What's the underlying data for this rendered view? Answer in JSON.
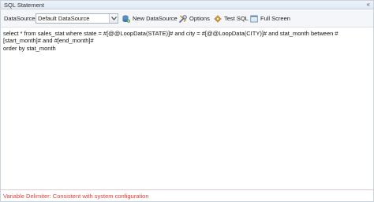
{
  "window": {
    "title": "SQL Statement"
  },
  "toolbar": {
    "datasource_label": "DataSource",
    "datasource_value": "Default DataSource",
    "buttons": [
      {
        "label": "New DataSource",
        "icon": "datasource-add-icon"
      },
      {
        "label": "Options",
        "icon": "options-icon"
      },
      {
        "label": "Test SQL",
        "icon": "test-sql-icon"
      },
      {
        "label": "Full Screen",
        "icon": "full-screen-icon"
      }
    ]
  },
  "editor": {
    "sql": "select * from sales_stat where state = #[@@LoopData(STATE)]# and city = #[@@LoopData(CITY)]# and stat_month between #[start_month]# and #[end_month]#\norder by stat_month"
  },
  "footer": {
    "text": "Variable Delimiter: Consistent with system configuration"
  },
  "colors": {
    "title_bar": "#e6edf5",
    "footer_text": "#e0403a",
    "border": "#c9d3de"
  }
}
